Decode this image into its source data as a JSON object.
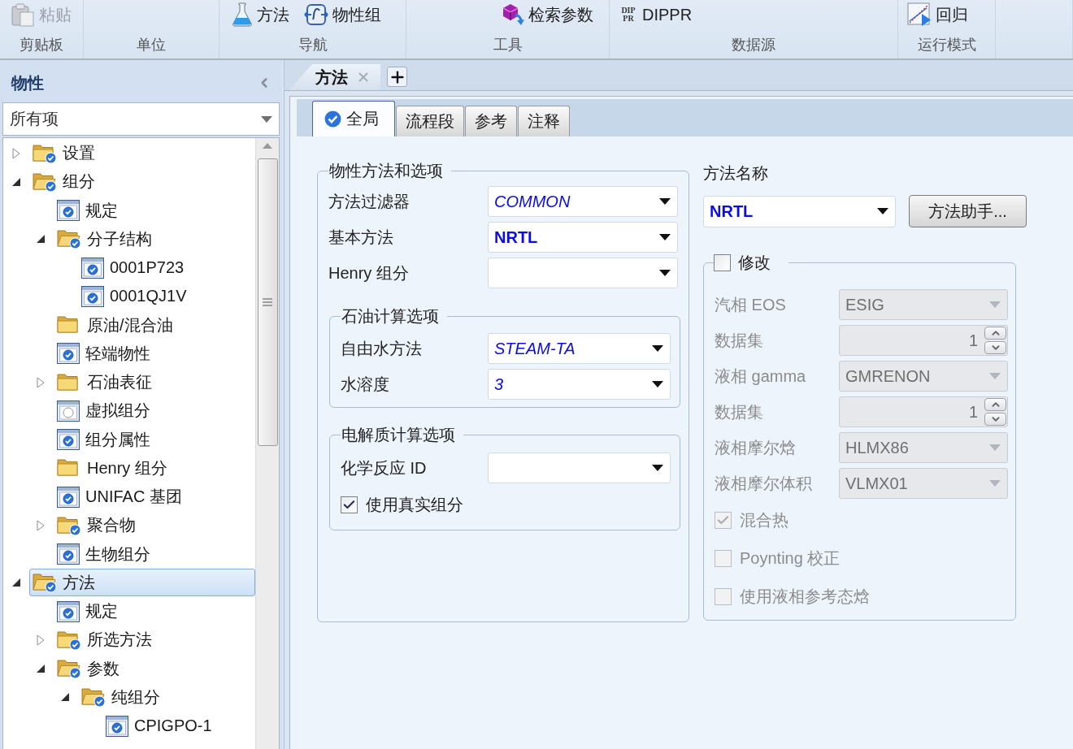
{
  "ribbon": {
    "groups": [
      {
        "label": "剪贴板",
        "buttons": [
          {
            "kind": "paste",
            "label": "粘贴",
            "disabled": true
          }
        ]
      },
      {
        "label": "单位"
      },
      {
        "label": "导航",
        "buttons": [
          {
            "kind": "flask",
            "label": "方法",
            "disabled": false
          },
          {
            "kind": "property-set",
            "label": "物性组",
            "disabled": false
          }
        ]
      },
      {
        "label": "工具",
        "buttons": [
          {
            "kind": "cube",
            "label": "检索参数",
            "disabled": false
          }
        ]
      },
      {
        "label": "数据源",
        "buttons": [
          {
            "kind": "logo",
            "label": "DIPPR",
            "logo": [
              "DIP",
              "PR"
            ],
            "disabled": false
          }
        ]
      },
      {
        "label": "运行模式",
        "buttons": [
          {
            "kind": "chart",
            "label": "回归",
            "disabled": false
          }
        ]
      }
    ]
  },
  "navigator": {
    "title": "物性",
    "filter": "所有项",
    "tree": [
      {
        "label": "设置",
        "kind": "folder",
        "complete": true,
        "expanded": false,
        "selected": false
      },
      {
        "label": "组分",
        "kind": "folder",
        "complete": true,
        "expanded": true,
        "selected": false,
        "children": [
          {
            "label": "规定",
            "kind": "form",
            "complete": true,
            "selected": false
          },
          {
            "label": "分子结构",
            "kind": "folder",
            "complete": true,
            "expanded": true,
            "selected": false,
            "children": [
              {
                "label": "0001P723",
                "kind": "form",
                "complete": true,
                "selected": false
              },
              {
                "label": "0001QJ1V",
                "kind": "form",
                "complete": true,
                "selected": false
              }
            ]
          },
          {
            "label": "原油/混合油",
            "kind": "folder",
            "complete": false,
            "selected": false
          },
          {
            "label": "轻端物性",
            "kind": "form",
            "complete": true,
            "selected": false
          },
          {
            "label": "石油表征",
            "kind": "folder",
            "complete": false,
            "expanded": false,
            "selected": false
          },
          {
            "label": "虚拟组分",
            "kind": "form",
            "complete": false,
            "selected": false
          },
          {
            "label": "组分属性",
            "kind": "form",
            "complete": true,
            "selected": false
          },
          {
            "label": "Henry 组分",
            "kind": "folder",
            "complete": false,
            "selected": false
          },
          {
            "label": "UNIFAC 基团",
            "kind": "form",
            "complete": true,
            "selected": false
          },
          {
            "label": "聚合物",
            "kind": "folder",
            "complete": true,
            "expanded": false,
            "selected": false
          },
          {
            "label": "生物组分",
            "kind": "form",
            "complete": true,
            "selected": false
          }
        ]
      },
      {
        "label": "方法",
        "kind": "folder",
        "complete": true,
        "expanded": true,
        "selected": true,
        "children": [
          {
            "label": "规定",
            "kind": "form",
            "complete": true,
            "selected": false
          },
          {
            "label": "所选方法",
            "kind": "folder",
            "complete": true,
            "expanded": false,
            "selected": false
          },
          {
            "label": "参数",
            "kind": "folder",
            "complete": true,
            "expanded": true,
            "selected": false,
            "children": [
              {
                "label": "纯组分",
                "kind": "folder",
                "complete": true,
                "expanded": true,
                "selected": false,
                "children": [
                  {
                    "label": "CPIGPO-1",
                    "kind": "form",
                    "complete": true,
                    "selected": false
                  }
                ]
              }
            ]
          }
        ]
      }
    ]
  },
  "document_tabs": [
    {
      "label": "方法",
      "selected": true
    }
  ],
  "form_tabs": [
    {
      "label": "全局",
      "selected": true,
      "complete": true
    },
    {
      "label": "流程段",
      "selected": false,
      "complete": false
    },
    {
      "label": "参考",
      "selected": false,
      "complete": false
    },
    {
      "label": "注释",
      "selected": false,
      "complete": false
    }
  ],
  "property_methods": {
    "title": "物性方法和选项",
    "fields": [
      {
        "label": "方法过滤器",
        "value": "COMMON",
        "entered": false
      },
      {
        "label": "基本方法",
        "value": "NRTL",
        "entered": true
      },
      {
        "label": "Henry 组分"
      }
    ],
    "petroleum": {
      "title": "石油计算选项",
      "fields": [
        {
          "label": "自由水方法",
          "value": "STEAM-TA",
          "entered": false
        },
        {
          "label": "水溶度",
          "value": "3",
          "entered": false
        }
      ]
    },
    "electrolyte": {
      "title": "电解质计算选项",
      "fields": [
        {
          "label": "化学反应 ID"
        }
      ],
      "option": {
        "label": "使用真实组分",
        "checked": true
      }
    }
  },
  "method_name": {
    "label": "方法名称",
    "value": "NRTL",
    "entered": true,
    "button": "方法助手..."
  },
  "modify": {
    "label": "修改",
    "checked": false,
    "rows": [
      {
        "kind": "combo",
        "label": "汽相 EOS",
        "value": "ESIG",
        "disabled": true
      },
      {
        "kind": "spinner",
        "label": "数据集",
        "value": "1",
        "disabled": true
      },
      {
        "kind": "combo",
        "label": "液相 gamma",
        "value": "GMRENON",
        "disabled": true
      },
      {
        "kind": "spinner",
        "label": "数据集",
        "value": "1",
        "disabled": true
      },
      {
        "kind": "combo",
        "label": "液相摩尔焓",
        "value": "HLMX86",
        "disabled": true
      },
      {
        "kind": "combo",
        "label": "液相摩尔体积",
        "value": "VLMX01",
        "disabled": true
      }
    ],
    "options": [
      {
        "label": "混合热",
        "checked": true,
        "disabled": true
      },
      {
        "label": "Poynting 校正",
        "checked": false,
        "disabled": true
      },
      {
        "label": "使用液相参考态焓",
        "checked": false,
        "disabled": true
      }
    ]
  }
}
